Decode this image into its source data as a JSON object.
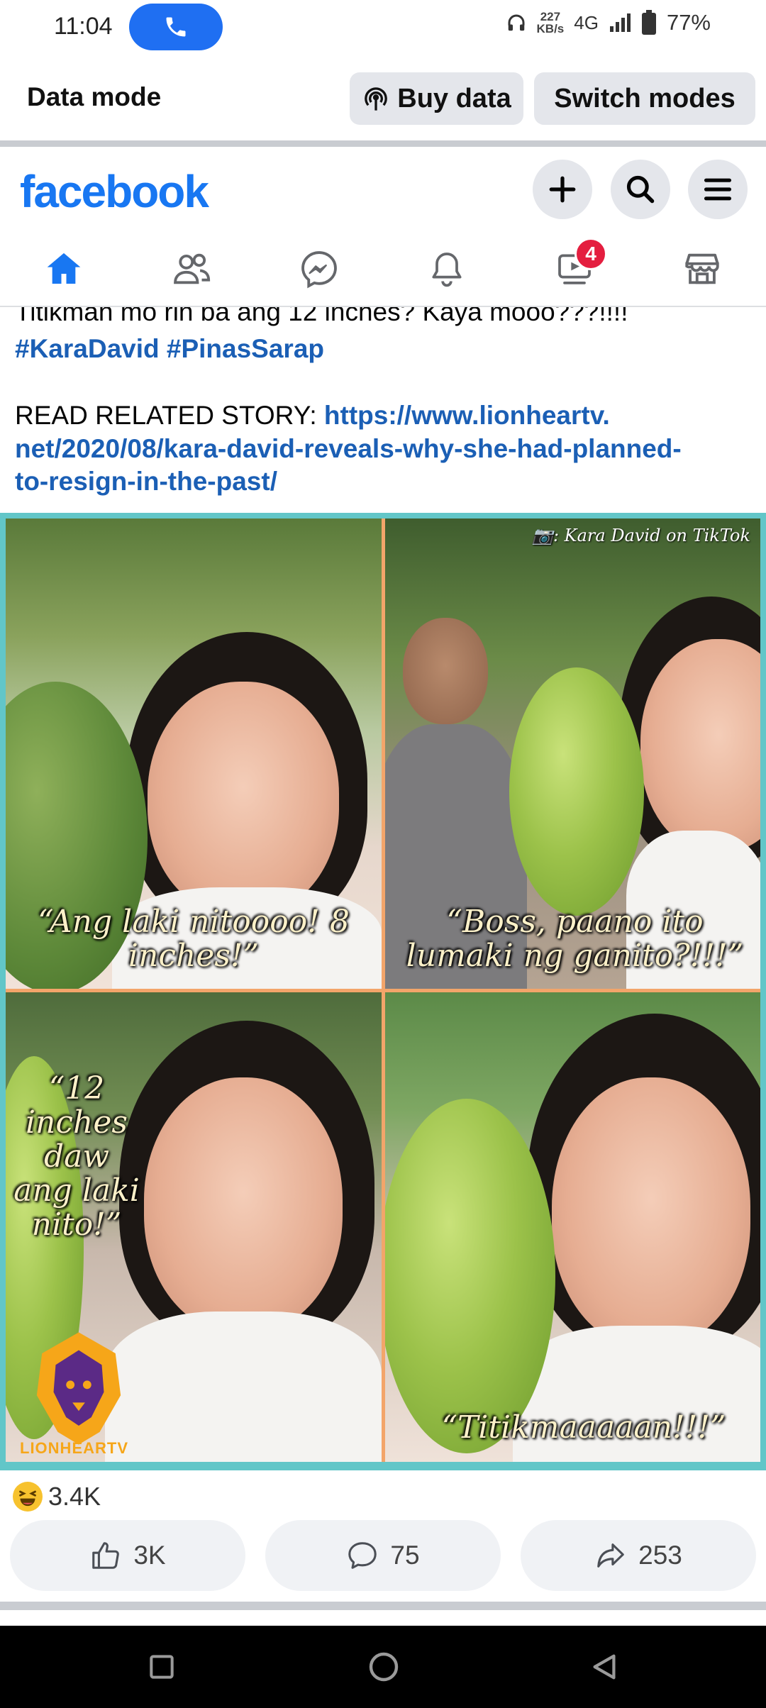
{
  "status_bar": {
    "time": "11:04",
    "net_speed_value": "227",
    "net_speed_unit": "KB/s",
    "network": "4G",
    "battery": "77%"
  },
  "data_mode": {
    "label": "Data mode",
    "buy_data": "Buy data",
    "switch_modes": "Switch modes"
  },
  "header": {
    "logo": "facebook"
  },
  "nav": {
    "tabs": [
      "home",
      "friends",
      "messenger",
      "notifications",
      "video",
      "marketplace"
    ],
    "active": "home",
    "video_badge": "4"
  },
  "post": {
    "cut_line": "Titikman mo rin ba ang 12 inches? Kaya mooo???!!!!",
    "hashtags": "#KaraDavid #PinasSarap",
    "read_label": "READ RELATED STORY: ",
    "link_1": "https://www.lionheartv.",
    "link_2": "net/2020/08/kara-david-reveals-why-she-had-planned-",
    "link_3": "to-resign-in-the-past/"
  },
  "collage": {
    "credit": "📷: Kara David on TikTok",
    "caption_1": "“Ang laki nitoooo! 8 inches!”",
    "caption_2": "“Boss, paano ito lumaki ng ganito?!!!”",
    "caption_3": "“12 inches daw ang laki nito!”",
    "caption_4": "“Titikmaaaaan!!!”",
    "brand": "LIONHEARTV"
  },
  "reactions": {
    "emoji": "laughing-emoji",
    "count": "3.4K"
  },
  "actions": {
    "like_count": "3K",
    "comment_count": "75",
    "share_count": "253"
  },
  "colors": {
    "fb_blue": "#1877f2",
    "link_blue": "#1b5fb5",
    "badge_red": "#e41e3f",
    "call_blue": "#1f6ff2"
  }
}
